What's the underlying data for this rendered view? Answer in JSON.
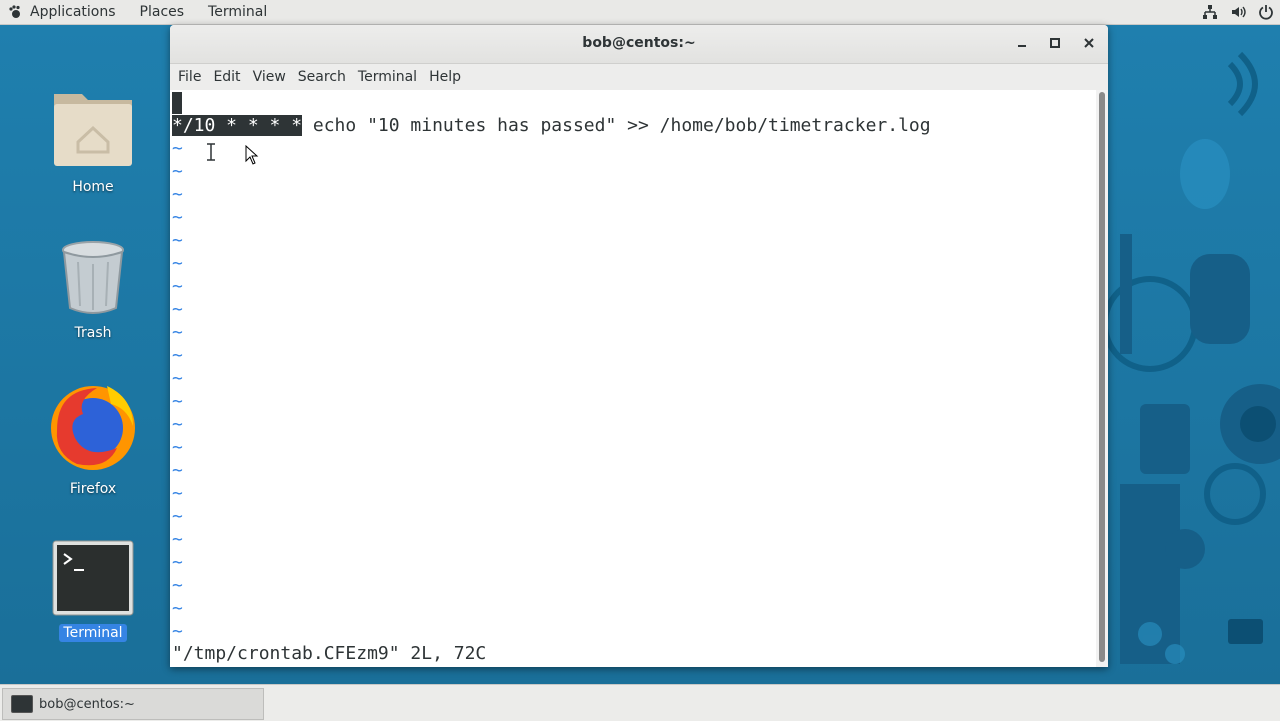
{
  "topbar": {
    "applications": "Applications",
    "places": "Places",
    "terminal": "Terminal",
    "icons": [
      "network-icon",
      "volume-icon",
      "power-icon"
    ]
  },
  "desktop": {
    "icons": [
      {
        "label": "Home",
        "icon": "folder-home-icon"
      },
      {
        "label": "Trash",
        "icon": "trash-icon"
      },
      {
        "label": "Firefox",
        "icon": "firefox-icon"
      },
      {
        "label": "Terminal",
        "icon": "terminal-icon"
      }
    ]
  },
  "window": {
    "title": "bob@centos:~",
    "menu": [
      "File",
      "Edit",
      "View",
      "Search",
      "Terminal",
      "Help"
    ]
  },
  "terminal": {
    "schedule": "*/10 * * * *",
    "command": " echo \"10 minutes has passed\" >> /home/bob/timetracker.log",
    "tilde": "~",
    "status_line": "\"/tmp/crontab.CFEzm9\" 2L, 72C"
  },
  "taskbar": {
    "task_label": "bob@centos:~"
  },
  "colors": {
    "desktop_bg": "#1e79a6",
    "vim_tilde": "#3584e4",
    "selection_bg": "#2e3436"
  }
}
